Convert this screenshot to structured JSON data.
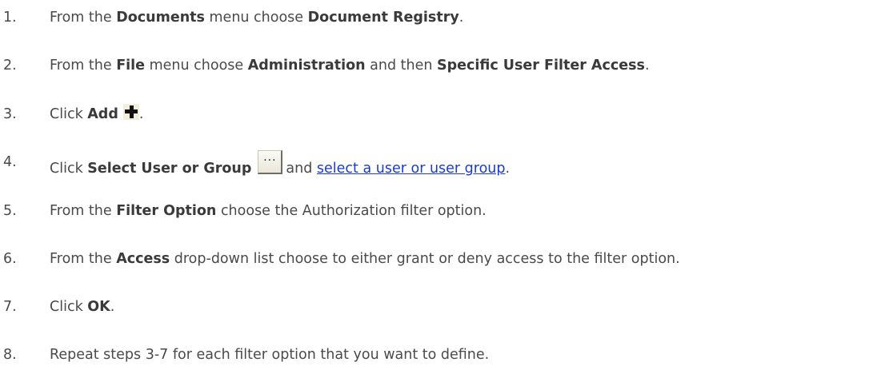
{
  "steps": [
    {
      "number": "1.",
      "parts": [
        "From the ",
        "Documents",
        " menu choose ",
        "Document Registry",
        "."
      ]
    },
    {
      "number": "2.",
      "parts": [
        "From the ",
        "File",
        " menu choose ",
        "Administration",
        " and then ",
        "Specific User Filter Access",
        "."
      ]
    },
    {
      "number": "3.",
      "parts": [
        "Click ",
        "Add",
        "."
      ],
      "icon": "plus-icon"
    },
    {
      "number": "4.",
      "parts": [
        "Click ",
        "Select User or Group",
        "and ",
        "select a user or user group",
        "."
      ],
      "icon": "ellipsis-button-icon",
      "button_text": "..."
    },
    {
      "number": "5.",
      "parts": [
        "From the ",
        "Filter Option",
        " choose the Authorization filter option."
      ]
    },
    {
      "number": "6.",
      "parts": [
        "From the ",
        "Access",
        " drop-down list choose to either grant or deny access to the filter option."
      ]
    },
    {
      "number": "7.",
      "parts": [
        "Click ",
        "OK",
        "."
      ]
    },
    {
      "number": "8.",
      "parts": [
        "Repeat steps 3-7 for each filter option that you want to define."
      ]
    }
  ],
  "colors": {
    "text": "#4a4a4a",
    "link": "#1a3cc8"
  }
}
